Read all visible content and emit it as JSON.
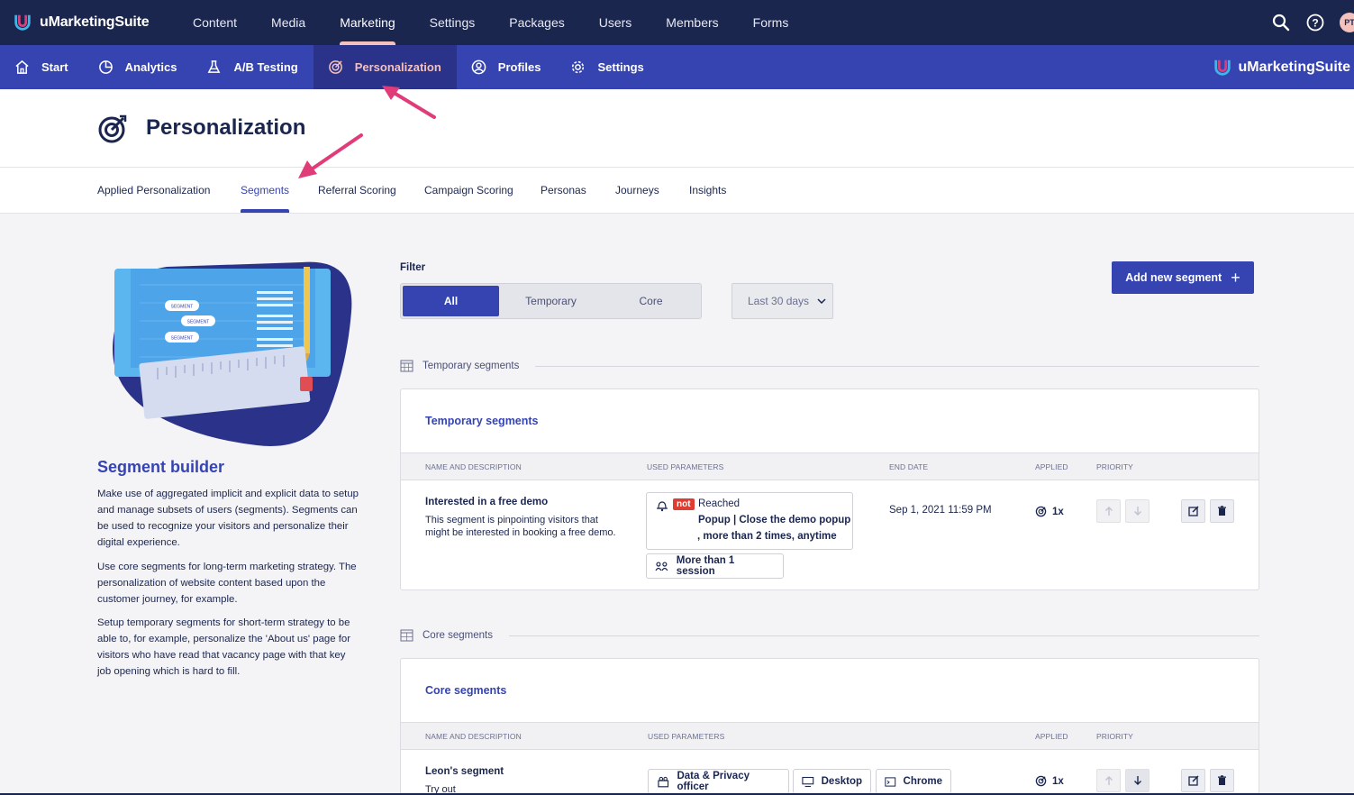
{
  "app": {
    "name": "uMarketingSuite",
    "avatar_initials": "PT"
  },
  "topnav": {
    "items": [
      {
        "label": "Content"
      },
      {
        "label": "Media"
      },
      {
        "label": "Marketing",
        "active": true
      },
      {
        "label": "Settings"
      },
      {
        "label": "Packages"
      },
      {
        "label": "Users"
      },
      {
        "label": "Members"
      },
      {
        "label": "Forms"
      }
    ],
    "icons": [
      "search-icon",
      "help-icon"
    ]
  },
  "subnav": {
    "items": [
      {
        "label": "Start",
        "icon": "home-icon"
      },
      {
        "label": "Analytics",
        "icon": "pie-chart-icon"
      },
      {
        "label": "A/B Testing",
        "icon": "flask-icon"
      },
      {
        "label": "Personalization",
        "icon": "target-icon",
        "active": true
      },
      {
        "label": "Profiles",
        "icon": "profile-icon"
      },
      {
        "label": "Settings",
        "icon": "gear-icon"
      }
    ],
    "brand": "uMarketingSuite"
  },
  "page": {
    "title": "Personalization"
  },
  "tabs": [
    {
      "label": "Applied Personalization"
    },
    {
      "label": "Segments",
      "active": true
    },
    {
      "label": "Referral Scoring"
    },
    {
      "label": "Campaign Scoring"
    },
    {
      "label": "Personas"
    },
    {
      "label": "Journeys"
    },
    {
      "label": "Insights"
    }
  ],
  "left_panel": {
    "illustration_labels": [
      "SEGMENT",
      "SEGMENT",
      "SEGMENT"
    ],
    "title": "Segment builder",
    "paragraphs": [
      "Make use of aggregated implicit and explicit data to setup and manage subsets of users (segments). Segments can be used to recognize your visitors and personalize their digital experience.",
      "Use core segments for long-term marketing strategy. The personalization of website content based upon the customer journey, for example.",
      "Setup temporary segments for short-term strategy to be able to, for example, personalize the 'About us' page for visitors who have read that vacancy page with that key job opening which is hard to fill."
    ]
  },
  "filter": {
    "label": "Filter",
    "options": [
      {
        "label": "All",
        "active": true
      },
      {
        "label": "Temporary"
      },
      {
        "label": "Core"
      }
    ],
    "date_range": "Last 30 days"
  },
  "add_button": {
    "label": "Add new segment",
    "icon": "plus-icon"
  },
  "temporary": {
    "divider_label": "Temporary segments",
    "card_title": "Temporary segments",
    "headers": {
      "name": "NAME AND DESCRIPTION",
      "params": "USED PARAMETERS",
      "end_date": "END DATE",
      "applied": "APPLIED",
      "priority": "PRIORITY"
    },
    "rows": [
      {
        "name": "Interested in a free demo",
        "description": "This segment is pinpointing visitors that might be interested in booking a free demo.",
        "param_not": "not",
        "param_line1": "Reached",
        "param_line2": "Popup | Close the demo popup",
        "param_line3": ", more than 2 times, anytime",
        "param_chip": "More than 1 session",
        "end_date": "Sep 1, 2021 11:59 PM",
        "applied": "1x"
      }
    ]
  },
  "core": {
    "divider_label": "Core segments",
    "card_title": "Core segments",
    "headers": {
      "name": "NAME AND DESCRIPTION",
      "params": "USED PARAMETERS",
      "applied": "APPLIED",
      "priority": "PRIORITY"
    },
    "rows": [
      {
        "name": "Leon's segment",
        "description": "Try out",
        "chips": [
          "Data & Privacy officer",
          "Desktop",
          "Chrome"
        ],
        "applied": "1x"
      }
    ]
  },
  "colors": {
    "primary": "#3544b1",
    "dark": "#1b264f",
    "accent": "#e03c7a",
    "not_badge": "#e03c31"
  }
}
